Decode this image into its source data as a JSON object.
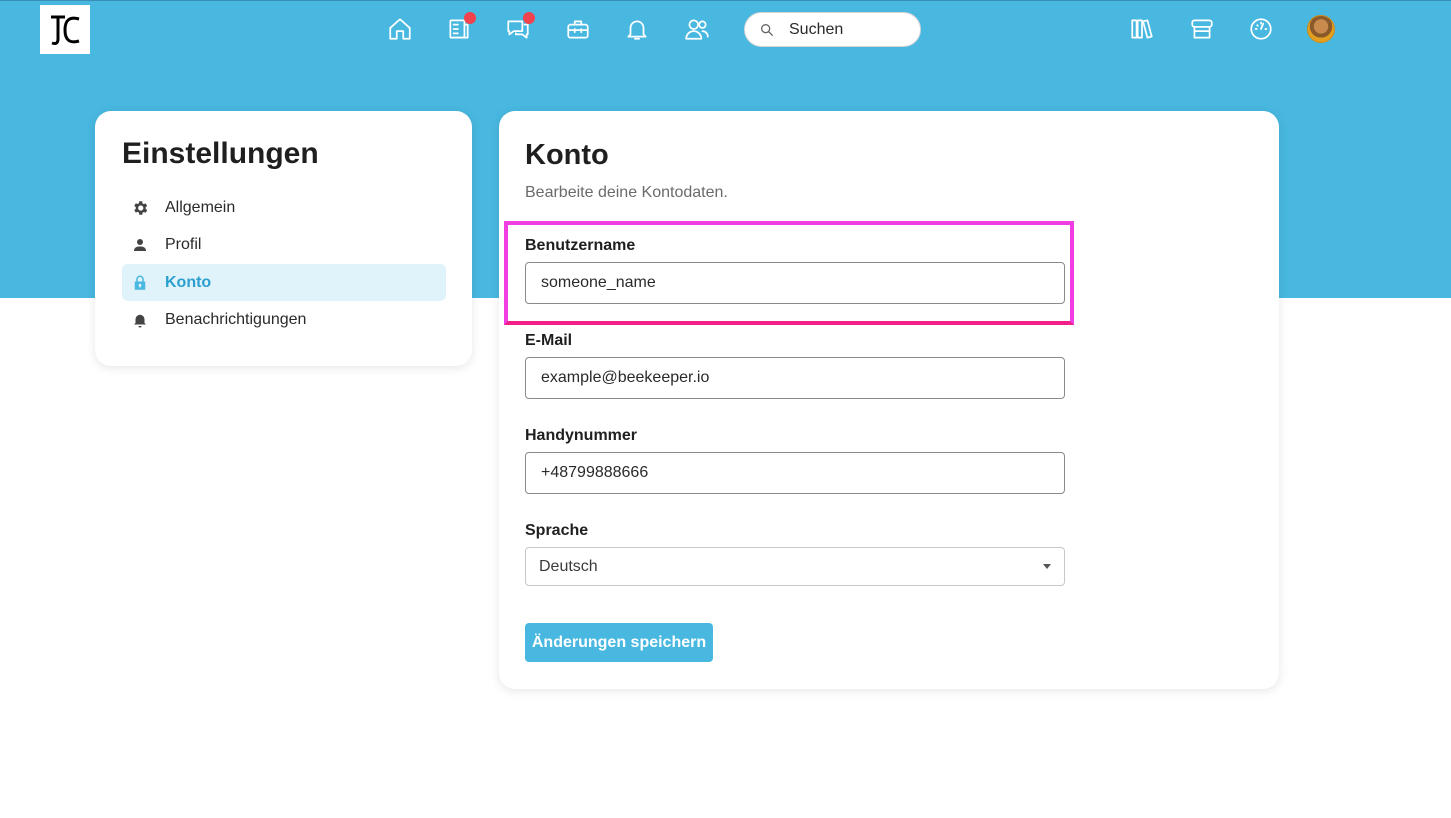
{
  "header": {
    "search": {
      "placeholder": "Suchen"
    },
    "nav_icons": [
      "home-icon",
      "news-icon",
      "chat-icon",
      "toolbox-icon",
      "bell-icon",
      "people-icon"
    ],
    "right_icons": [
      "library-icon",
      "store-icon",
      "dashboard-icon"
    ],
    "badges": {
      "news": true,
      "chat": true
    },
    "colors": {
      "brand": "#48b8e0",
      "badge": "#f0434d",
      "highlight": "#f03ee0"
    }
  },
  "sidebar": {
    "title": "Einstellungen",
    "items": [
      {
        "label": "Allgemein",
        "icon": "gear-icon",
        "active": false
      },
      {
        "label": "Profil",
        "icon": "person-icon",
        "active": false
      },
      {
        "label": "Konto",
        "icon": "lock-icon",
        "active": true
      },
      {
        "label": "Benachrichtigungen",
        "icon": "bell-icon",
        "active": false
      }
    ]
  },
  "account": {
    "title": "Konto",
    "subtitle": "Bearbeite deine Kontodaten.",
    "fields": {
      "username": {
        "label": "Benutzername",
        "value": "someone_name"
      },
      "email": {
        "label": "E-Mail",
        "value": "example@beekeeper.io"
      },
      "phone": {
        "label": "Handynummer",
        "value": "+48799888666"
      },
      "language": {
        "label": "Sprache",
        "value": "Deutsch"
      }
    },
    "save_label": "Änderungen speichern"
  }
}
